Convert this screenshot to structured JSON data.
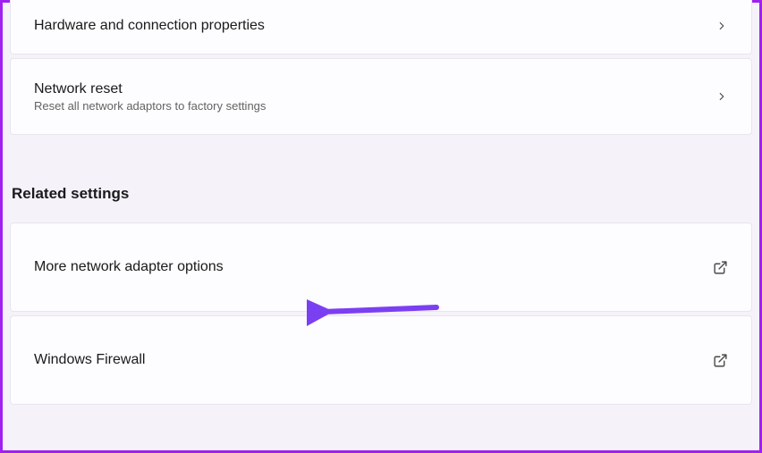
{
  "settings": {
    "hardware": {
      "title": "Hardware and connection properties"
    },
    "networkReset": {
      "title": "Network reset",
      "subtitle": "Reset all network adaptors to factory settings"
    }
  },
  "relatedSettings": {
    "header": "Related settings",
    "moreAdapter": {
      "title": "More network adapter options"
    },
    "firewall": {
      "title": "Windows Firewall"
    }
  },
  "annotation": {
    "arrowColor": "#7b3ff2"
  }
}
